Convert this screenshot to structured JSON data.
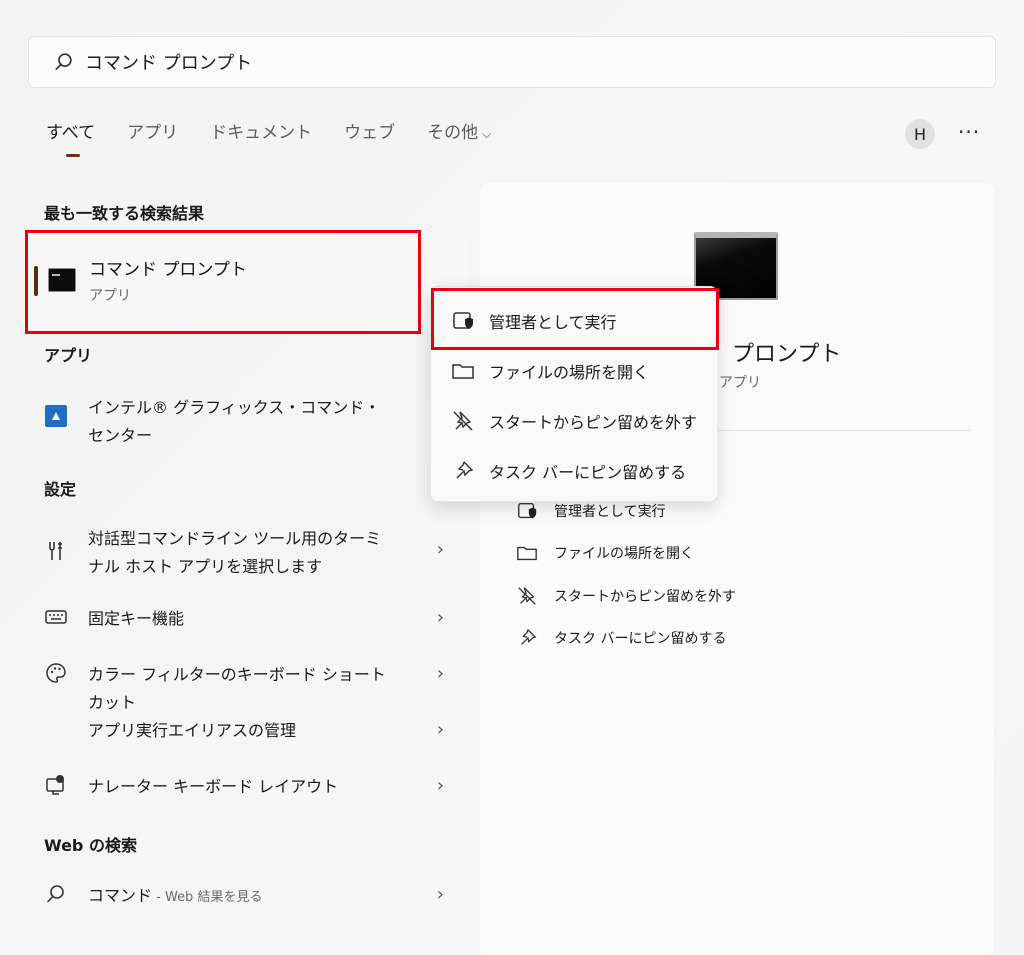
{
  "search": {
    "value": "コマンド プロンプト"
  },
  "tabs": [
    {
      "label": "すべて"
    },
    {
      "label": "アプリ"
    },
    {
      "label": "ドキュメント"
    },
    {
      "label": "ウェブ"
    },
    {
      "label": "その他"
    }
  ],
  "header": {
    "avatar_letter": "H",
    "more_label": "···"
  },
  "best_match": {
    "heading": "最も一致する検索結果",
    "title": "コマンド プロンプト",
    "subtitle": "アプリ"
  },
  "apps": {
    "heading": "アプリ",
    "items": [
      {
        "label": "インテル® グラフィックス・コマンド・センター"
      }
    ]
  },
  "settings": {
    "heading": "設定",
    "items": [
      {
        "label": "対話型コマンドライン ツール用のターミナル ホスト アプリを選択します",
        "icon": "tools-icon"
      },
      {
        "label": "固定キー機能",
        "icon": "keyboard-icon"
      },
      {
        "label": "カラー フィルターのキーボード ショートカット",
        "icon": "palette-icon"
      },
      {
        "label": "アプリ実行エイリアスの管理",
        "icon": ""
      },
      {
        "label": "ナレーター キーボード レイアウト",
        "icon": "narrator-icon"
      }
    ]
  },
  "web": {
    "heading": "Web の検索",
    "query": "コマンド",
    "suffix": " - Web 結果を見る"
  },
  "preview": {
    "title": "コマンド プロンプト",
    "title_visible": "プロンプト",
    "subtitle": "アプリ",
    "actions": [
      {
        "label": "管理者として実行",
        "icon": "shield-icon"
      },
      {
        "label": "ファイルの場所を開く",
        "icon": "folder-icon"
      },
      {
        "label": "スタートからピン留めを外す",
        "icon": "unpin-icon"
      },
      {
        "label": "タスク バーにピン留めする",
        "icon": "pin-icon"
      }
    ]
  },
  "context_menu": {
    "items": [
      {
        "label": "管理者として実行",
        "icon": "shield-icon"
      },
      {
        "label": "ファイルの場所を開く",
        "icon": "folder-icon"
      },
      {
        "label": "スタートからピン留めを外す",
        "icon": "unpin-icon"
      },
      {
        "label": "タスク バーにピン留めする",
        "icon": "pin-icon"
      }
    ]
  },
  "colors": {
    "highlight": "#e60012",
    "accent": "#6b2f1a"
  }
}
